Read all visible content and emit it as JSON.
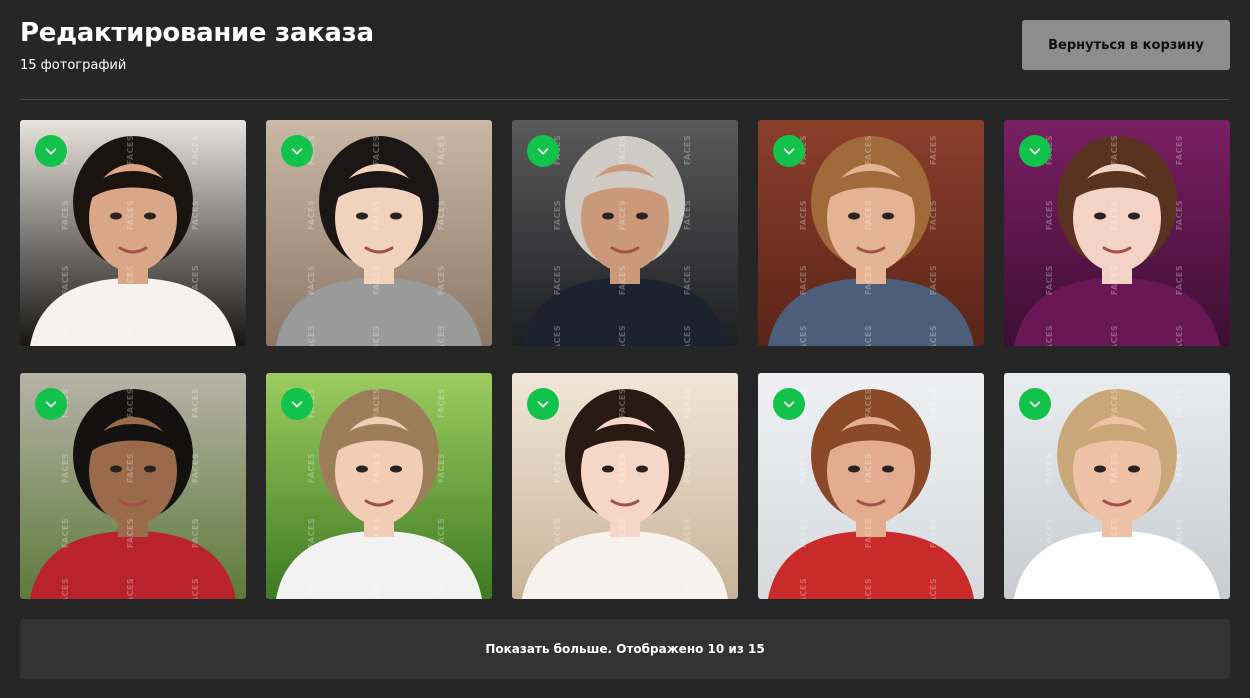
{
  "header": {
    "title": "Редактирование заказа",
    "subtitle": "15 фотографий"
  },
  "back_button": {
    "label": "Вернуться в корзину"
  },
  "gallery": {
    "watermark": "FACES",
    "check_icon": "check-icon",
    "photos": [
      {
        "name": "photo-woman-dark-hair",
        "selected": true,
        "bg": [
          "#e8e2dc",
          "#1a1512"
        ],
        "skin": "#d9a688",
        "hair": "#1b130e",
        "cloth": "#f4f1ee"
      },
      {
        "name": "photo-child-black-hood",
        "selected": true,
        "bg": [
          "#c9b8a6",
          "#8c7766"
        ],
        "skin": "#f1d2bd",
        "hair": "#1c1616",
        "cloth": "#9a9a9a"
      },
      {
        "name": "photo-grey-bearded-man",
        "selected": true,
        "bg": [
          "#5a5a5a",
          "#1e1f22"
        ],
        "skin": "#c99979",
        "hair": "#cfcac4",
        "cloth": "#1c2230"
      },
      {
        "name": "photo-man-brick-wall",
        "selected": true,
        "bg": [
          "#8b3f2c",
          "#5a2418"
        ],
        "skin": "#e4b394",
        "hair": "#a06a3a",
        "cloth": "#4d5e7a"
      },
      {
        "name": "photo-girl-purple-scarf",
        "selected": true,
        "bg": [
          "#7a1f63",
          "#3d0e33"
        ],
        "skin": "#f2d3c6",
        "hair": "#5a3320",
        "cloth": "#6a1855"
      },
      {
        "name": "photo-boy-red-jacket",
        "selected": true,
        "bg": [
          "#b7b3a8",
          "#5d7a3a"
        ],
        "skin": "#9b6a4a",
        "hair": "#141210",
        "cloth": "#b9232c"
      },
      {
        "name": "photo-girl-in-grass",
        "selected": true,
        "bg": [
          "#9ccc60",
          "#3e7a22"
        ],
        "skin": "#f0cdb4",
        "hair": "#9c7d59",
        "cloth": "#f2f2f2"
      },
      {
        "name": "photo-girl-flower-headband",
        "selected": true,
        "bg": [
          "#f0e6d8",
          "#c8b39a"
        ],
        "skin": "#f6d7c7",
        "hair": "#2a1a14",
        "cloth": "#f7f2ee"
      },
      {
        "name": "photo-woman-red-jacket",
        "selected": true,
        "bg": [
          "#eef0f3",
          "#d5d9de"
        ],
        "skin": "#e3ac8f",
        "hair": "#8a4a2a",
        "cloth": "#c92a2a"
      },
      {
        "name": "photo-blonde-woman-smiling",
        "selected": true,
        "bg": [
          "#e9ecef",
          "#c6ccd2"
        ],
        "skin": "#eec0a5",
        "hair": "#c9a778",
        "cloth": "#ffffff"
      }
    ]
  },
  "show_more": {
    "label": "Показать больше. Отображено 10 из 15"
  }
}
